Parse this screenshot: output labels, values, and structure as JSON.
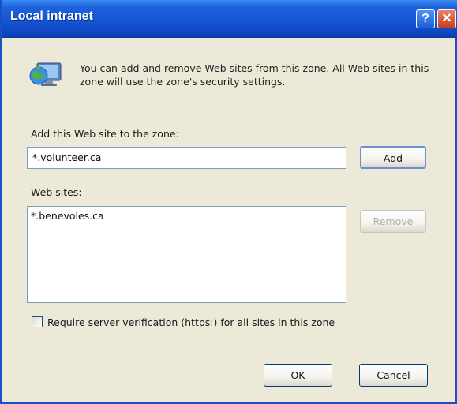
{
  "window": {
    "title": "Local intranet",
    "help_glyph": "?",
    "close_glyph": "✕"
  },
  "description": "You can add and remove Web sites from this zone. All Web sites in this zone will use the zone's security settings.",
  "add_section": {
    "label": "Add this Web site to the zone:",
    "input_value": "*.volunteer.ca",
    "add_button": "Add"
  },
  "sites_section": {
    "label": "Web sites:",
    "items": [
      "*.benevoles.ca"
    ],
    "remove_button": "Remove"
  },
  "require_verification": {
    "label": "Require server verification (https:) for all sites in this zone",
    "checked": false
  },
  "footer": {
    "ok_button": "OK",
    "cancel_button": "Cancel"
  },
  "icons": {
    "zone": "local-intranet-globe-monitor-icon",
    "help": "help-icon",
    "close": "close-icon"
  },
  "colors": {
    "titlebar": "#1656d6",
    "dialog_bg": "#ece9d8",
    "close_btn": "#c5401d"
  }
}
